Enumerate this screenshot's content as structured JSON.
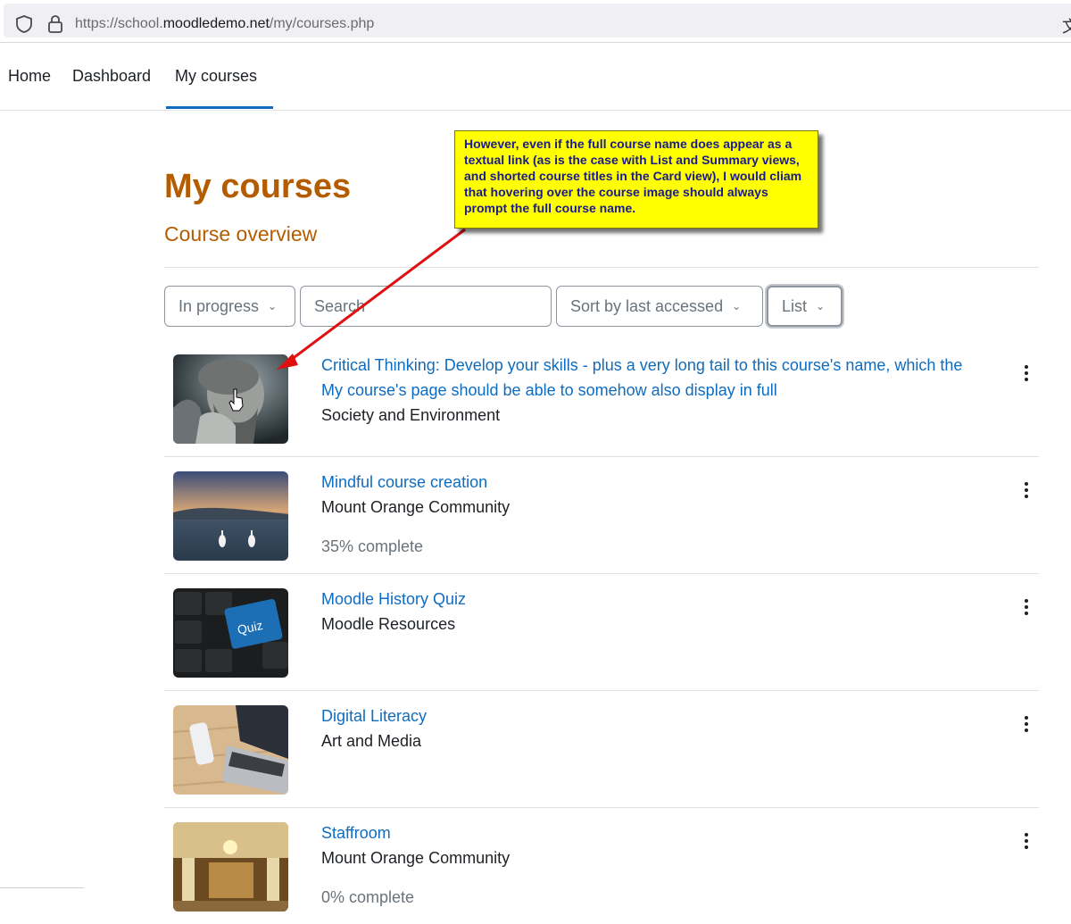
{
  "browser": {
    "url_prefix": "https://school.",
    "url_host": "moodledemo.net",
    "url_path": "/my/courses.php"
  },
  "nav": {
    "items": [
      {
        "label": "Home"
      },
      {
        "label": "Dashboard"
      },
      {
        "label": "My courses",
        "active": true
      }
    ]
  },
  "annotation": {
    "text": "However, even if the full course name does appear as a textual link (as is the case with List and Summary views, and shorted course titles in the Card view), I would cliam that hovering over the course image should always prompt the full course name."
  },
  "page": {
    "title": "My courses",
    "section": "Course overview"
  },
  "controls": {
    "grouping": "In progress",
    "search_placeholder": "Search",
    "sort": "Sort by last accessed",
    "view": "List"
  },
  "courses": [
    {
      "name": "Critical Thinking: Develop your skills - plus a very long tail to this course's name, which the My course's page should be able to somehow also display in full",
      "category": "Society and Environment",
      "progress": ""
    },
    {
      "name": "Mindful course creation",
      "category": "Mount Orange Community",
      "progress": "35% complete"
    },
    {
      "name": "Moodle History Quiz",
      "category": "Moodle Resources",
      "progress": ""
    },
    {
      "name": "Digital Literacy",
      "category": "Art and Media",
      "progress": ""
    },
    {
      "name": "Staffroom",
      "category": "Mount Orange Community",
      "progress": "0% complete"
    }
  ],
  "thumb_labels": {
    "quiz_key": "Quiz"
  },
  "colors": {
    "accent": "#0f6cbf",
    "heading": "#b35c00",
    "callout_bg": "#ffff00",
    "callout_text": "#1a1a8c",
    "arrow": "#e01010"
  }
}
